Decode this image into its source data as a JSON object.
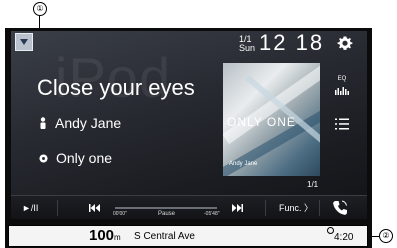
{
  "callouts": [
    "①",
    "②"
  ],
  "header": {
    "date_top": "1/1",
    "date_day": "Sun",
    "time": "12 18"
  },
  "watermark": "iPod",
  "now_playing": {
    "title": "Close your eyes",
    "artist": "Andy Jane",
    "album": "Only one",
    "track_count": "1/1"
  },
  "album_art": {
    "title": "ONLY ONE",
    "artist": "Andy Jane"
  },
  "sidebar": {
    "eq_label": "EQ"
  },
  "controls": {
    "play_pause": "►/II",
    "elapsed": "00'00\"",
    "status": "Pause",
    "remaining": "-05'48\"",
    "func_label": "Func. 〉",
    "progress": 0
  },
  "navigation": {
    "distance": "100",
    "distance_unit": "m",
    "street": "S Central Ave",
    "time": "4:20"
  },
  "icons": [
    "menu-icon",
    "gear-icon",
    "person-icon",
    "disc-icon",
    "eq-icon",
    "list-icon",
    "previous-icon",
    "next-icon",
    "phone-icon"
  ]
}
